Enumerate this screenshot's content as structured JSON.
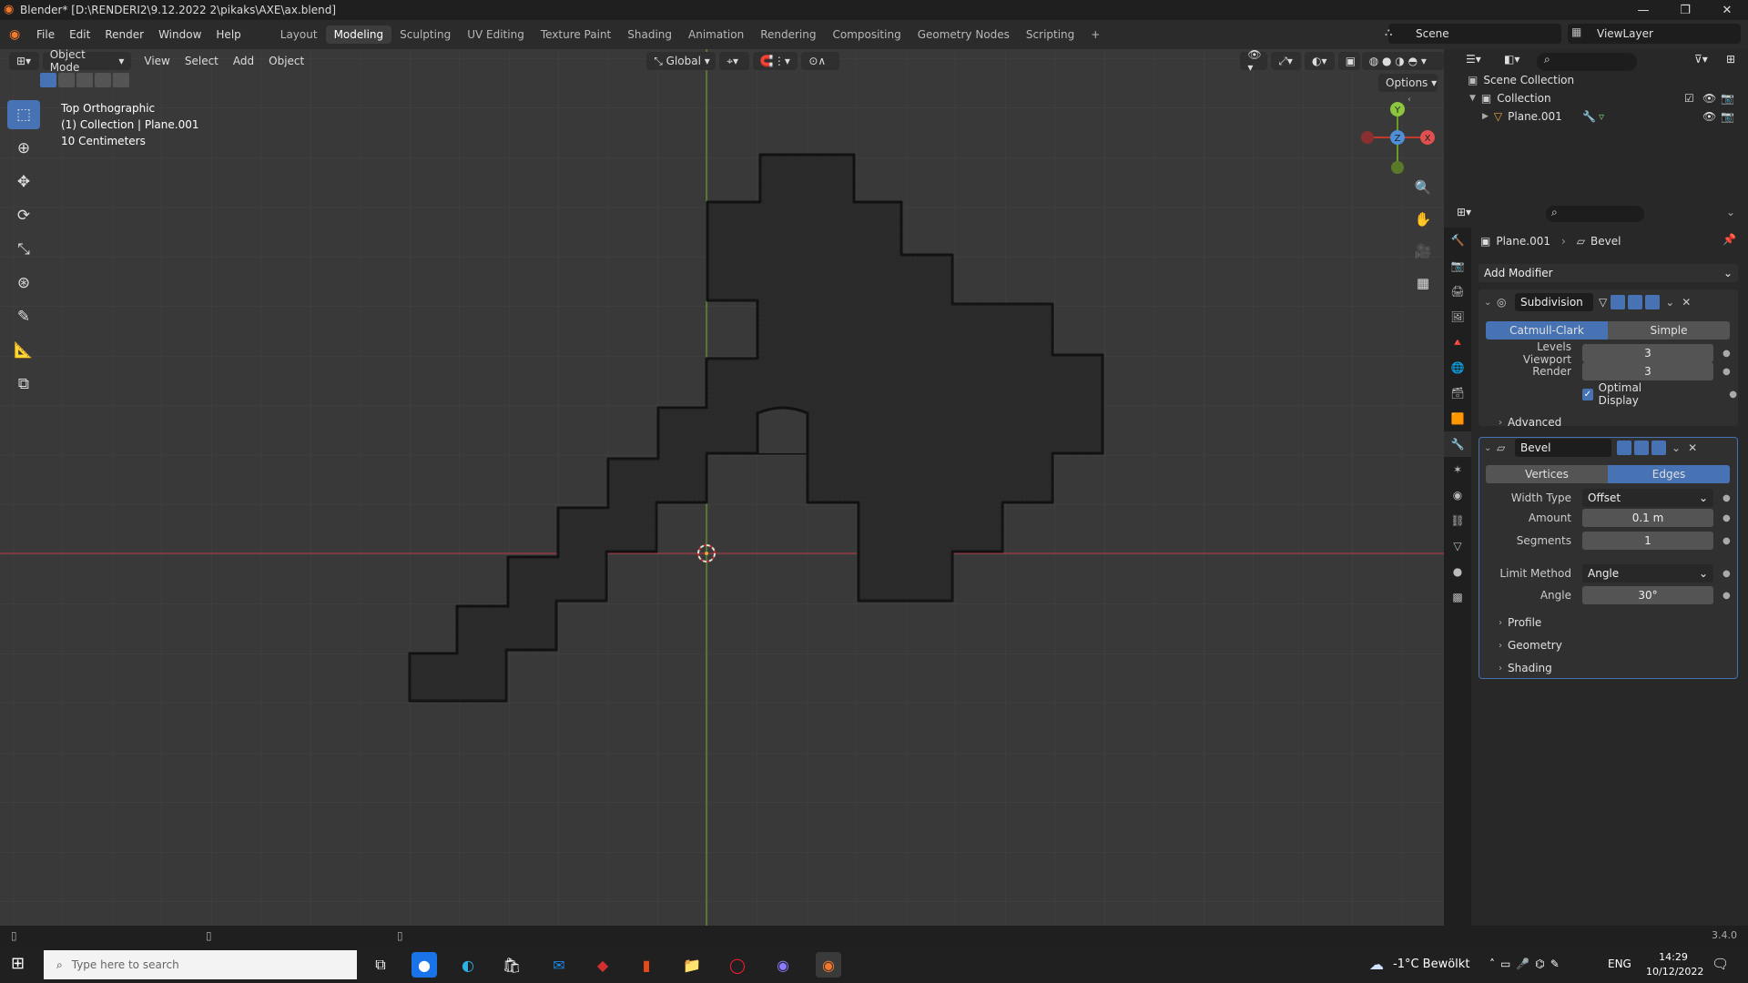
{
  "window": {
    "title": "Blender* [D:\\RENDERI2\\9.12.2022 2\\pikaks\\AXE\\ax.blend]",
    "minimize": "—",
    "maximize": "❐",
    "close": "✕"
  },
  "menus": [
    "File",
    "Edit",
    "Render",
    "Window",
    "Help"
  ],
  "workspaces": [
    "Layout",
    "Modeling",
    "Sculpting",
    "UV Editing",
    "Texture Paint",
    "Shading",
    "Animation",
    "Rendering",
    "Compositing",
    "Geometry Nodes",
    "Scripting"
  ],
  "active_workspace": "Modeling",
  "add_workspace": "+",
  "scene": {
    "name": "Scene"
  },
  "view_layer": {
    "name": "ViewLayer"
  },
  "viewport_header": {
    "mode": "Object Mode",
    "menus": [
      "View",
      "Select",
      "Add",
      "Object"
    ],
    "orientation": "Global"
  },
  "viewport": {
    "view_name": "Top Orthographic",
    "collection_info": "(1) Collection | Plane.001",
    "scale": "10 Centimeters",
    "options": "Options",
    "gizmo": {
      "y": "Y",
      "z": "Z",
      "x": "X"
    },
    "colors": {
      "background": "#393939",
      "grid": "#424242",
      "x_axis": "#a33a45",
      "y_axis": "#6b9a2a",
      "mesh_fill": "#2a2a2a",
      "mesh_outline": "#111111"
    }
  },
  "outliner": {
    "root": "Scene Collection",
    "collection": "Collection",
    "object": "Plane.001"
  },
  "properties": {
    "breadcrumb_object": "Plane.001",
    "breadcrumb_modifier": "Bevel",
    "add_modifier": "Add Modifier",
    "subdivision": {
      "name": "Subdivision",
      "type_catmull": "Catmull-Clark",
      "type_simple": "Simple",
      "levels_viewport_label": "Levels Viewport",
      "levels_viewport": "3",
      "render_label": "Render",
      "render": "3",
      "optimal_display": "Optimal Display",
      "advanced": "Advanced"
    },
    "bevel": {
      "name": "Bevel",
      "vertices": "Vertices",
      "edges": "Edges",
      "width_type_label": "Width Type",
      "width_type": "Offset",
      "amount_label": "Amount",
      "amount": "0.1 m",
      "segments_label": "Segments",
      "segments": "1",
      "limit_method_label": "Limit Method",
      "limit_method": "Angle",
      "angle_label": "Angle",
      "angle": "30°",
      "profile": "Profile",
      "geometry": "Geometry",
      "shading": "Shading"
    },
    "accent": "#4772b3"
  },
  "status": {
    "version": "3.4.0"
  },
  "taskbar": {
    "search_placeholder": "Type here to search",
    "weather": "-1°C  Bewölkt",
    "lang": "ENG",
    "time": "14:29",
    "date": "10/12/2022"
  }
}
